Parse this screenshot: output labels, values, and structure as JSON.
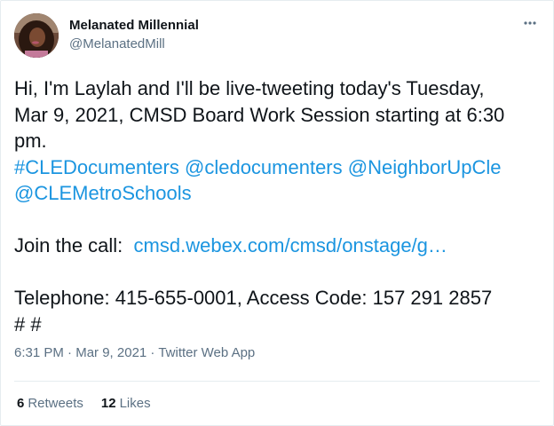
{
  "author": {
    "name": "Melanated Millennial",
    "handle": "@MelanatedMill",
    "avatar_icon": "profile-photo"
  },
  "more_icon": "more-dots-icon",
  "body": {
    "line1": "Hi, I'm Laylah and I'll be live-tweeting today's Tuesday,",
    "line2": "Mar 9, 2021, CMSD Board Work Session starting at 6:30",
    "line3": "pm.",
    "hashtag": "#CLEDocumenters",
    "mention1": "@cledocumenters",
    "mention2": "@NeighborUpCle",
    "mention3": "@CLEMetroSchools",
    "join_label": "Join the call:",
    "join_link": "cmsd.webex.com/cmsd/onstage/g…",
    "telephone": "Telephone:  415-655-0001, Access Code:  157 291 2857",
    "hashes": "# #"
  },
  "meta": {
    "time": "6:31 PM",
    "sep1": " · ",
    "date": "Mar 9, 2021",
    "sep2": " · ",
    "source": "Twitter Web App"
  },
  "stats": {
    "retweets_count": "6",
    "retweets_label": "Retweets",
    "likes_count": "12",
    "likes_label": "Likes"
  },
  "colors": {
    "link": "#1b95e0",
    "secondary_text": "#5b7083",
    "primary_text": "#0f1419",
    "border": "#e6ecf0"
  }
}
